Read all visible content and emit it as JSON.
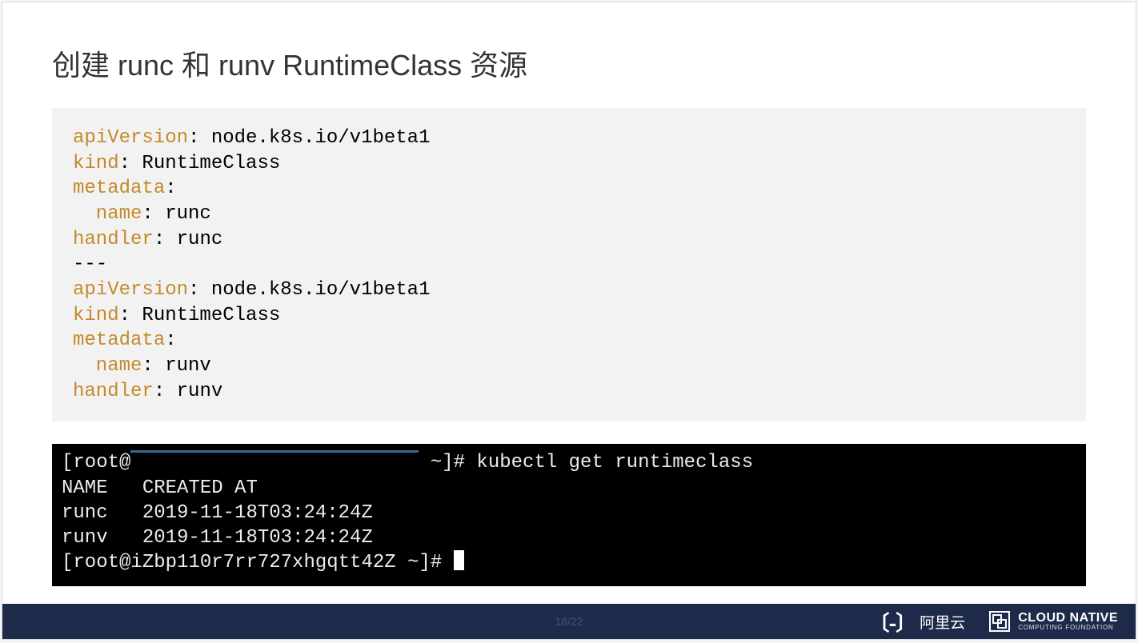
{
  "title": "创建 runc 和 runv RuntimeClass 资源",
  "yaml": {
    "doc1": {
      "apiVersion_key": "apiVersion",
      "apiVersion_val": ": node.k8s.io/v1beta1",
      "kind_key": "kind",
      "kind_val": ": RuntimeClass",
      "metadata_key": "metadata",
      "metadata_val": ":",
      "name_key": "  name",
      "name_val": ": runc",
      "handler_key": "handler",
      "handler_val": ": runc"
    },
    "sep": "---",
    "doc2": {
      "apiVersion_key": "apiVersion",
      "apiVersion_val": ": node.k8s.io/v1beta1",
      "kind_key": "kind",
      "kind_val": ": RuntimeClass",
      "metadata_key": "metadata",
      "metadata_val": ":",
      "name_key": "  name",
      "name_val": ": runv",
      "handler_key": "handler",
      "handler_val": ": runv"
    }
  },
  "terminal": {
    "line1_prefix": "[root@",
    "line1_suffix": " ~]# kubectl get runtimeclass",
    "header": "NAME   CREATED AT",
    "row1": "runc   2019-11-18T03:24:24Z",
    "row2": "runv   2019-11-18T03:24:24Z",
    "prompt": "[root@iZbp110r7rr727xhgqtt42Z ~]# "
  },
  "footer": {
    "page": "18/22",
    "ali_bracket": "〔-〕",
    "ali_text": "阿里云",
    "cncf_main": "CLOUD NATIVE",
    "cncf_sub": "COMPUTING FOUNDATION"
  }
}
